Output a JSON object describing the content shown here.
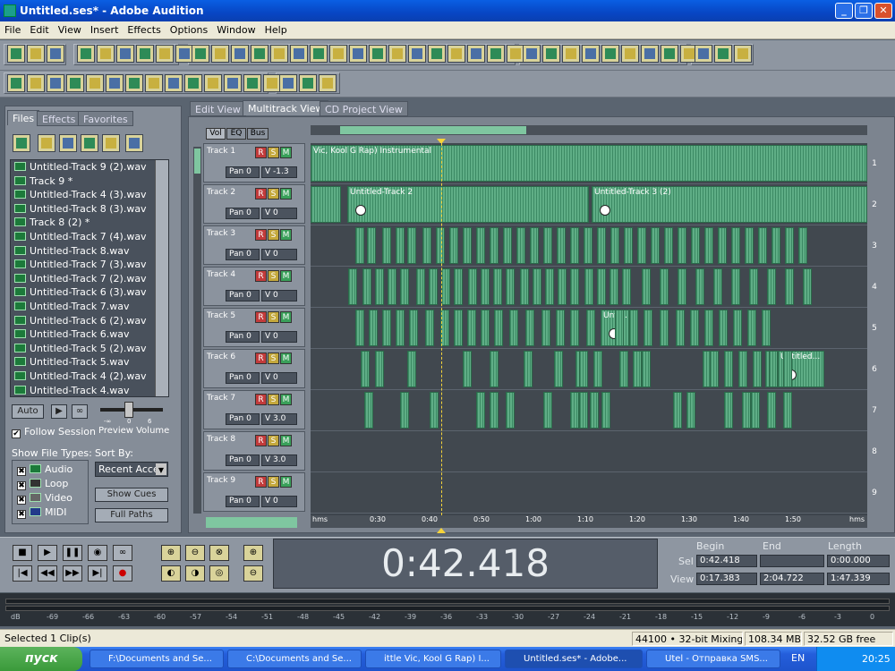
{
  "window": {
    "title": "Untitled.ses* - Adobe Audition"
  },
  "menu": [
    "File",
    "Edit",
    "View",
    "Insert",
    "Effects",
    "Options",
    "Window",
    "Help"
  ],
  "left_panel": {
    "tabs": [
      "Files",
      "Effects",
      "Favorites"
    ],
    "files": [
      "Untitled-Track 9 (2).wav",
      "Track 9 *",
      "Untitled-Track 4 (3).wav",
      "Untitled-Track 8 (3).wav",
      "Track 8 (2) *",
      "Untitled-Track 7 (4).wav",
      "Untitled-Track 8.wav",
      "Untitled-Track 7 (3).wav",
      "Untitled-Track 7 (2).wav",
      "Untitled-Track 6 (3).wav",
      "Untitled-Track 7.wav",
      "Untitled-Track 6 (2).wav",
      "Untitled-Track 6.wav",
      "Untitled-Track 5 (2).wav",
      "Untitled-Track 5.wav",
      "Untitled-Track 4 (2).wav",
      "Untitled-Track 4.wav"
    ],
    "auto_button": "Auto",
    "follow_session": "Follow Session",
    "preview_volume": "Preview Volume",
    "vol_marks": [
      "-∞",
      "0",
      "6"
    ],
    "show_types_label": "Show File Types:",
    "types": [
      "Audio",
      "Loop",
      "Video",
      "MIDI"
    ],
    "sort_by_label": "Sort By:",
    "sort_value": "Recent Acce",
    "show_cues": "Show Cues",
    "full_paths": "Full Paths"
  },
  "view_tabs": [
    "Edit View",
    "Multitrack View",
    "CD Project View"
  ],
  "track_header_tabs": [
    "Vol",
    "EQ",
    "Bus"
  ],
  "tracks": [
    {
      "name": "Track 1",
      "pan": "Pan 0",
      "vol": "V -1.3",
      "num": "1"
    },
    {
      "name": "Track 2",
      "pan": "Pan 0",
      "vol": "V 0",
      "num": "2"
    },
    {
      "name": "Track 3",
      "pan": "Pan 0",
      "vol": "V 0",
      "num": "3"
    },
    {
      "name": "Track 4",
      "pan": "Pan 0",
      "vol": "V 0",
      "num": "4"
    },
    {
      "name": "Track 5",
      "pan": "Pan 0",
      "vol": "V 0",
      "num": "5"
    },
    {
      "name": "Track 6",
      "pan": "Pan 0",
      "vol": "V 0",
      "num": "6"
    },
    {
      "name": "Track 7",
      "pan": "Pan 0",
      "vol": "V 3.0",
      "num": "7"
    },
    {
      "name": "Track 8",
      "pan": "Pan 0",
      "vol": "V 3.0",
      "num": "8"
    },
    {
      "name": "Track 9",
      "pan": "Pan 0",
      "vol": "V 0",
      "num": "9"
    }
  ],
  "rsm": [
    "R",
    "S",
    "M"
  ],
  "clip_labels": {
    "track1": "Vic, Kool G Rap) Instrumental",
    "track2a": "Untitled-Track 2",
    "track2b": "Untitled-Track 3 (2)",
    "track5": "Unti...",
    "track6": "Untitled..."
  },
  "ruler": [
    "hms",
    "0:30",
    "0:40",
    "0:50",
    "1:00",
    "1:10",
    "1:20",
    "1:30",
    "1:40",
    "1:50",
    "hms"
  ],
  "time_display": "0:42.418",
  "selection": {
    "headers": [
      "Begin",
      "End",
      "Length"
    ],
    "sel_label": "Sel",
    "view_label": "View",
    "sel": [
      "0:42.418",
      "",
      "0:00.000"
    ],
    "view": [
      "0:17.383",
      "2:04.722",
      "1:47.339"
    ]
  },
  "meter_scale": [
    "dB",
    "-69",
    "-66",
    "-63",
    "-60",
    "-57",
    "-54",
    "-51",
    "-48",
    "-45",
    "-42",
    "-39",
    "-36",
    "-33",
    "-30",
    "-27",
    "-24",
    "-21",
    "-18",
    "-15",
    "-12",
    "-9",
    "-6",
    "-3",
    "0"
  ],
  "status": {
    "left": "Selected 1 Clip(s)",
    "rate": "44100 • 32-bit Mixing",
    "mem": "108.34 MB",
    "disk": "32.52 GB free"
  },
  "taskbar": {
    "start": "пуск",
    "tasks": [
      "F:\\Documents and Se...",
      "C:\\Documents and Se...",
      "ittle Vic, Kool G Rap) I...",
      "Untitled.ses* - Adobe...",
      "Utel - Отправка SMS..."
    ],
    "lang": "EN",
    "clock": "20:25"
  },
  "colors": {
    "clip": "#5fae86",
    "panel": "#858d98",
    "titlebar": "#0746c4"
  }
}
